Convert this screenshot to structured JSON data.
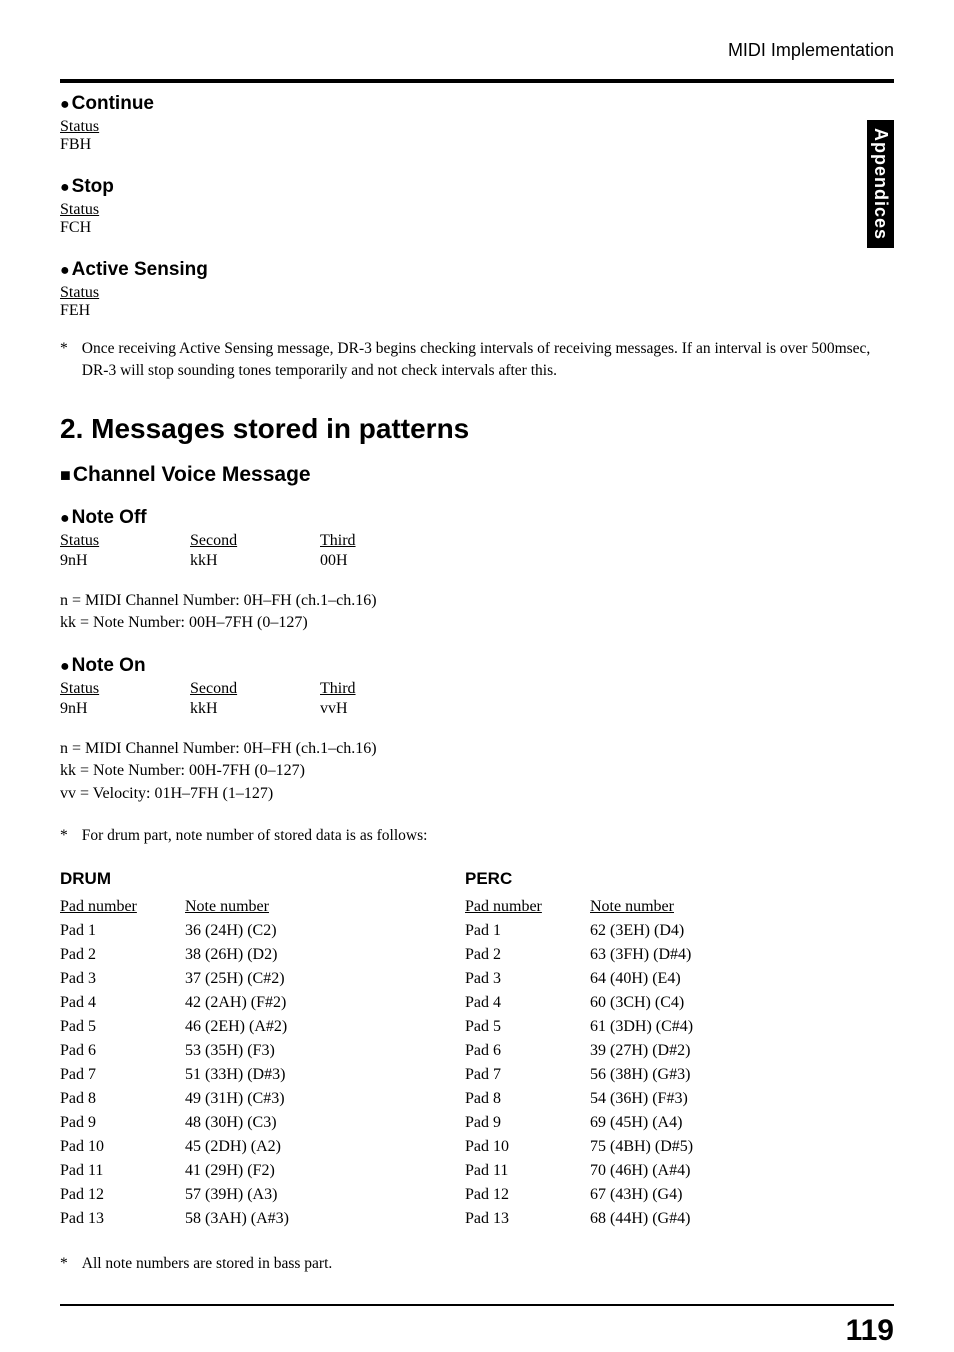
{
  "header": {
    "title": "MIDI Implementation"
  },
  "sidetab": "Appendices",
  "continue": {
    "heading": "Continue",
    "status_label": "Status",
    "status_value": "FBH"
  },
  "stop": {
    "heading": "Stop",
    "status_label": "Status",
    "status_value": "FCH"
  },
  "active_sensing": {
    "heading": "Active Sensing",
    "status_label": "Status",
    "status_value": "FEH",
    "note": "Once receiving Active Sensing message, DR-3 begins checking intervals of receiving messages. If an interval is over 500msec, DR-3 will stop sounding tones temporarily and not check intervals after this."
  },
  "section2": {
    "title": "2. Messages stored in patterns",
    "subtitle": "Channel Voice Message"
  },
  "note_off": {
    "heading": "Note Off",
    "cols": [
      "Status",
      "Second",
      "Third"
    ],
    "vals": [
      "9nH",
      "kkH",
      "00H"
    ],
    "params": [
      "n = MIDI Channel Number: 0H–FH (ch.1–ch.16)",
      "kk = Note Number: 00H–7FH (0–127)"
    ]
  },
  "note_on": {
    "heading": "Note On",
    "cols": [
      "Status",
      "Second",
      "Third"
    ],
    "vals": [
      "9nH",
      "kkH",
      "vvH"
    ],
    "params": [
      "n = MIDI Channel Number: 0H–FH (ch.1–ch.16)",
      "kk = Note Number: 00H-7FH (0–127)",
      "vv = Velocity: 01H–7FH (1–127)"
    ],
    "note": "For drum part, note number of stored data is as follows:"
  },
  "drum": {
    "title": "DRUM",
    "head": [
      "Pad number",
      "Note number"
    ],
    "rows": [
      [
        "Pad 1",
        "36 (24H) (C2)"
      ],
      [
        "Pad 2",
        "38 (26H) (D2)"
      ],
      [
        "Pad 3",
        "37 (25H) (C#2)"
      ],
      [
        "Pad 4",
        "42 (2AH) (F#2)"
      ],
      [
        "Pad 5",
        "46 (2EH) (A#2)"
      ],
      [
        "Pad 6",
        "53 (35H) (F3)"
      ],
      [
        "Pad 7",
        "51 (33H) (D#3)"
      ],
      [
        "Pad 8",
        "49 (31H) (C#3)"
      ],
      [
        "Pad 9",
        "48 (30H) (C3)"
      ],
      [
        "Pad 10",
        "45 (2DH) (A2)"
      ],
      [
        "Pad 11",
        "41 (29H) (F2)"
      ],
      [
        "Pad 12",
        "57 (39H) (A3)"
      ],
      [
        "Pad 13",
        "58 (3AH) (A#3)"
      ]
    ]
  },
  "perc": {
    "title": "PERC",
    "head": [
      "Pad number",
      "Note number"
    ],
    "rows": [
      [
        "Pad 1",
        "62 (3EH) (D4)"
      ],
      [
        "Pad 2",
        "63 (3FH) (D#4)"
      ],
      [
        "Pad 3",
        "64 (40H) (E4)"
      ],
      [
        "Pad 4",
        "60 (3CH) (C4)"
      ],
      [
        "Pad 5",
        "61 (3DH) (C#4)"
      ],
      [
        "Pad 6",
        "39 (27H) (D#2)"
      ],
      [
        "Pad 7",
        "56 (38H) (G#3)"
      ],
      [
        "Pad 8",
        "54 (36H) (F#3)"
      ],
      [
        "Pad 9",
        "69 (45H) (A4)"
      ],
      [
        "Pad 10",
        "75 (4BH) (D#5)"
      ],
      [
        "Pad 11",
        "70 (46H) (A#4)"
      ],
      [
        "Pad 12",
        "67 (43H) (G4)"
      ],
      [
        "Pad 13",
        "68 (44H) (G#4)"
      ]
    ]
  },
  "bass_note": "All note numbers are stored in bass part.",
  "page_number": "119"
}
